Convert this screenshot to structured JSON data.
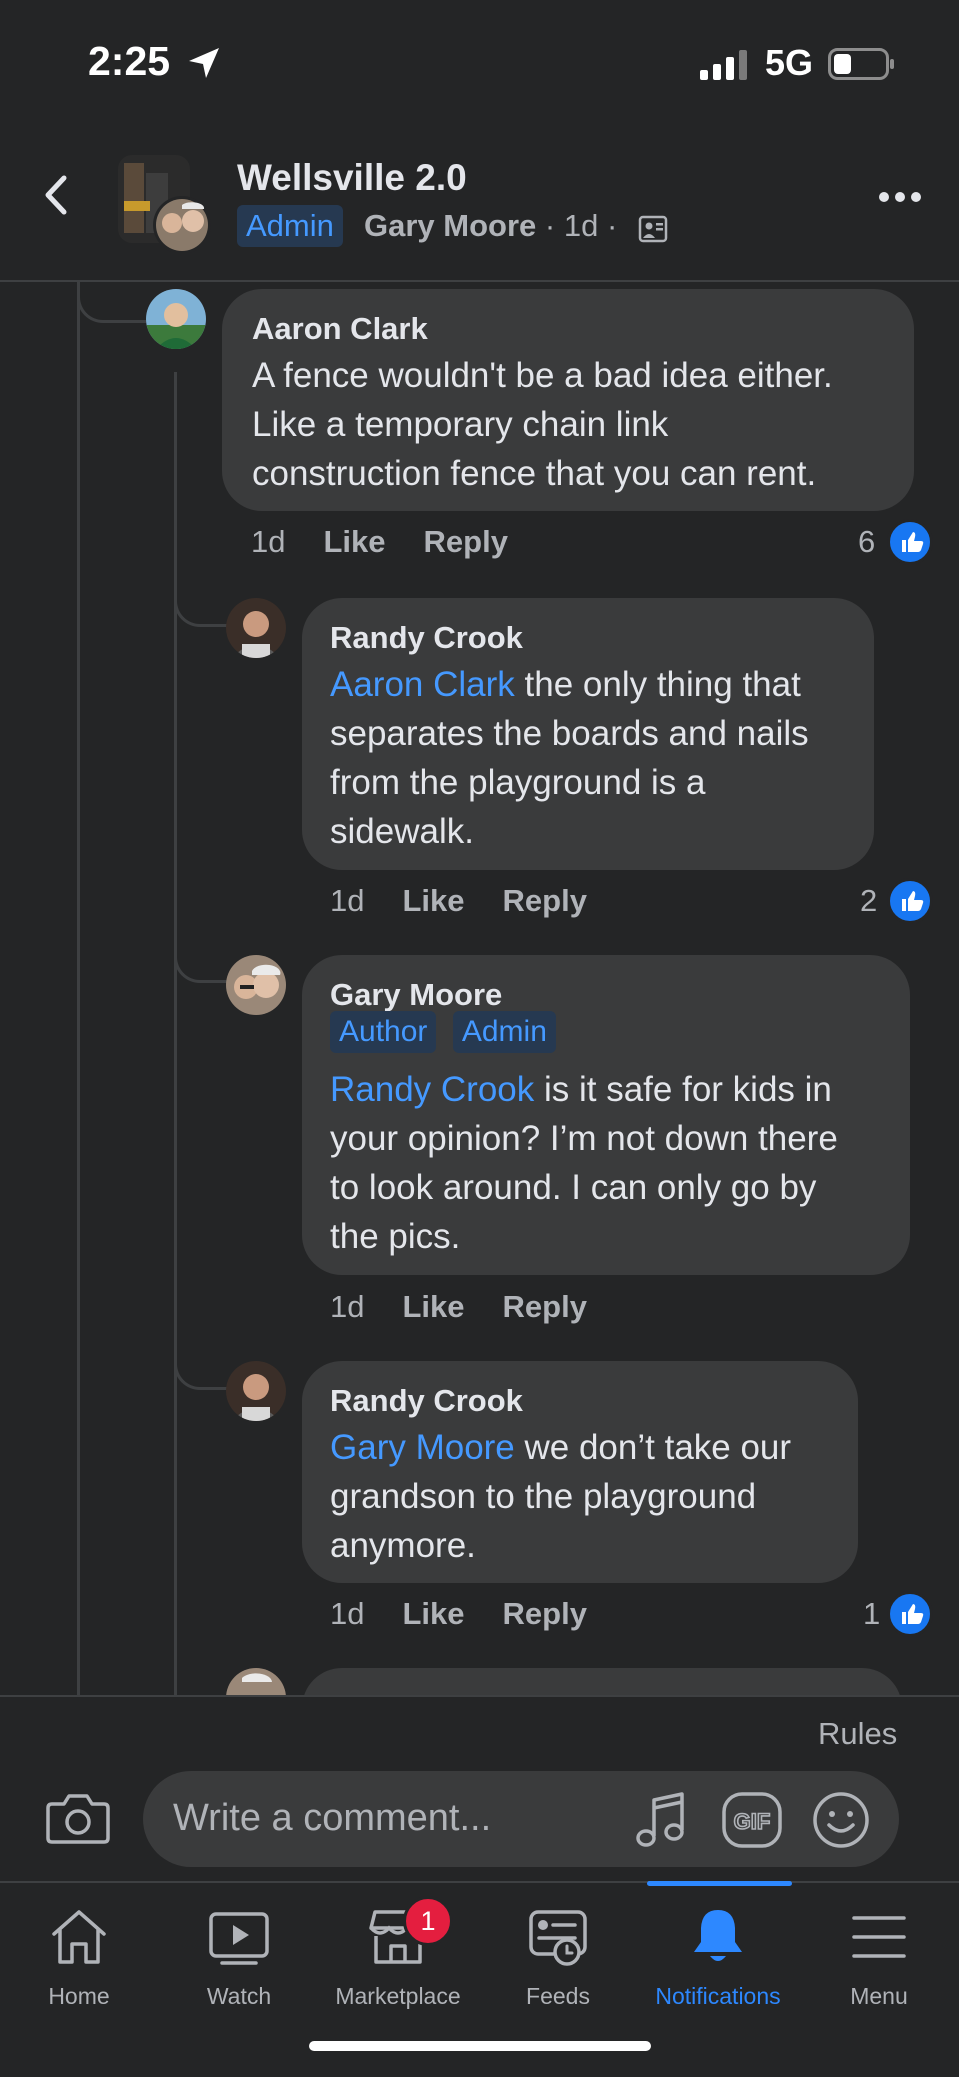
{
  "status_bar": {
    "time": "2:25",
    "network": "5G"
  },
  "header": {
    "title": "Wellsville 2.0",
    "badge": "Admin",
    "author": "Gary Moore",
    "sep": " · ",
    "age": "1d",
    "sep2": " ·"
  },
  "comments": [
    {
      "author": "Aaron Clark",
      "lines": [
        "A fence wouldn't be a bad idea either.",
        "Like a temporary chain link",
        "construction fence that you can rent."
      ],
      "age": "1d",
      "like_label": "Like",
      "reply_label": "Reply",
      "reactions": "6"
    },
    {
      "author": "Randy Crook",
      "mention": "Aaron Clark",
      "lines": [
        " the only thing that",
        "separates the boards and nails",
        "from the playground is a",
        "sidewalk."
      ],
      "age": "1d",
      "like_label": "Like",
      "reply_label": "Reply",
      "reactions": "2"
    },
    {
      "author": "Gary Moore",
      "chips": [
        "Author",
        "Admin"
      ],
      "mention": "Randy Crook",
      "lines": [
        " is it safe for kids in",
        "your opinion? I’m not down there",
        "to look around. I can only go by",
        "the pics."
      ],
      "age": "1d",
      "like_label": "Like",
      "reply_label": "Reply"
    },
    {
      "author": "Randy Crook",
      "mention": "Gary Moore",
      "lines": [
        " we don’t take our",
        "grandson to the playground",
        "anymore."
      ],
      "age": "1d",
      "like_label": "Like",
      "reply_label": "Reply",
      "reactions": "1"
    }
  ],
  "composer": {
    "rules": "Rules",
    "placeholder": "Write a comment..."
  },
  "nav": {
    "items": [
      {
        "label": "Home",
        "icon": "home-icon"
      },
      {
        "label": "Watch",
        "icon": "watch-icon"
      },
      {
        "label": "Marketplace",
        "icon": "marketplace-icon",
        "badge": "1"
      },
      {
        "label": "Feeds",
        "icon": "feeds-icon"
      },
      {
        "label": "Notifications",
        "icon": "bell-icon",
        "active": true
      },
      {
        "label": "Menu",
        "icon": "menu-icon"
      }
    ]
  },
  "colors": {
    "background": "#242526",
    "bubble": "#3a3b3c",
    "accent": "#2d88ff",
    "mention": "#4599ff"
  }
}
